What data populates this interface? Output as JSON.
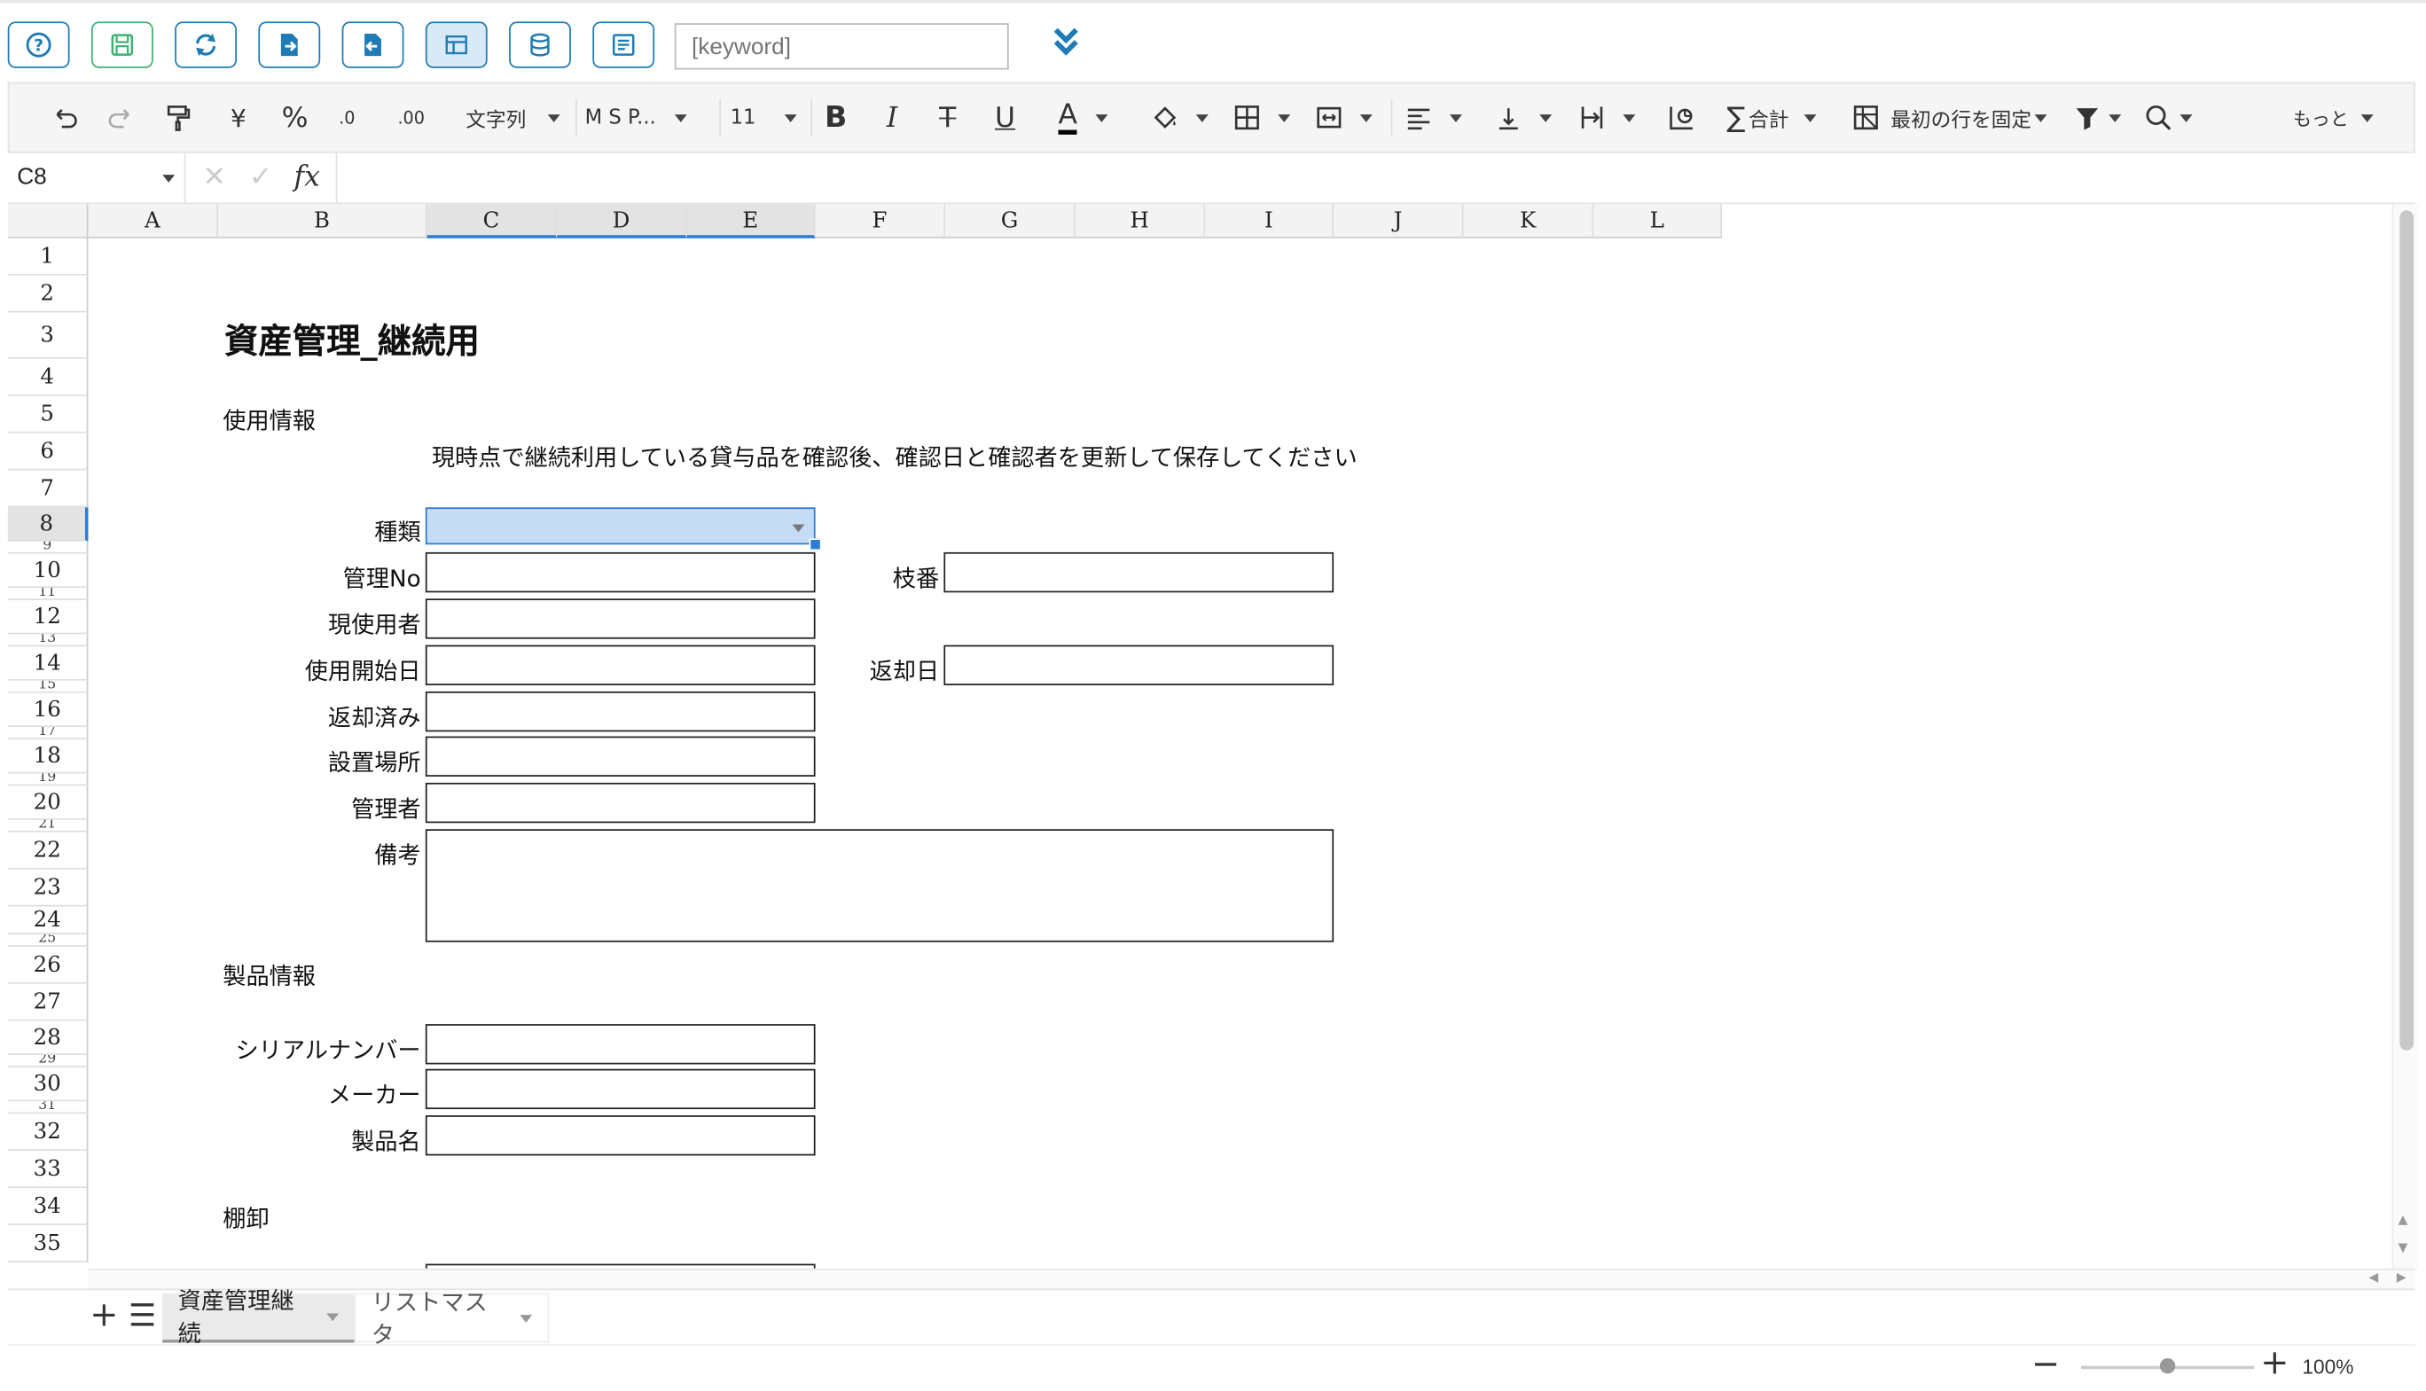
{
  "toolbar": {
    "keyword_placeholder": "[keyword]"
  },
  "ribbon": {
    "currency": "¥",
    "percent": "%",
    "decimal_inc": ".0",
    "decimal_dec": ".00",
    "number_format": "文字列",
    "font_name": "M S P...",
    "font_size": "11",
    "bold": "B",
    "italic": "I",
    "strike": "T",
    "underline": "U",
    "font_color": "A",
    "sum": "合計",
    "freeze": "最初の行を固定",
    "more": "もっと"
  },
  "formula_bar": {
    "cell_ref": "C8",
    "fx": "fx"
  },
  "columns": [
    "A",
    "B",
    "C",
    "D",
    "E",
    "F",
    "G",
    "H",
    "I",
    "J",
    "K",
    "L"
  ],
  "rows": {
    "normal": [
      "1",
      "2",
      "3",
      "4",
      "5",
      "6",
      "7",
      "8",
      "10",
      "12",
      "14",
      "16",
      "18",
      "20",
      "22",
      "23",
      "24",
      "26",
      "27",
      "28",
      "30",
      "32",
      "33",
      "34",
      "35"
    ],
    "tiny": [
      "9",
      "11",
      "13",
      "15",
      "17",
      "19",
      "21",
      "25",
      "29",
      "31"
    ]
  },
  "sheet": {
    "title": "資産管理_継続用",
    "section_usage": "使用情報",
    "instruction": "現時点で継続利用している貸与品を確認後、確認日と確認者を更新して保存してください",
    "labels": {
      "kind": "種類",
      "mgmt_no": "管理No",
      "branch_no": "枝番",
      "current_user": "現使用者",
      "start_date": "使用開始日",
      "return_date": "返却日",
      "returned": "返却済み",
      "location": "設置場所",
      "manager": "管理者",
      "notes": "備考"
    },
    "section_product": "製品情報",
    "product_labels": {
      "serial": "シリアルナンバー",
      "maker": "メーカー",
      "product_name": "製品名"
    },
    "section_inventory": "棚卸"
  },
  "tabs": [
    {
      "label": "資産管理継続"
    },
    {
      "label": "リストマスタ"
    }
  ],
  "status": {
    "zoom": "100%",
    "zoom_fraction": 0.5
  }
}
